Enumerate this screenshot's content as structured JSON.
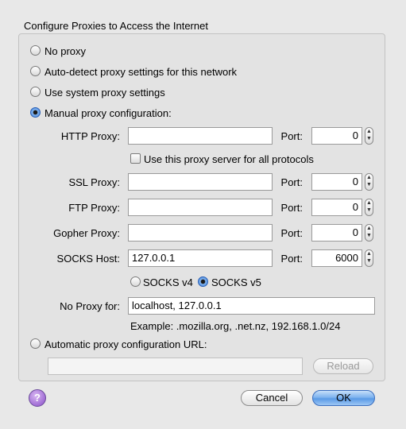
{
  "dialog": {
    "title": "Configure Proxies to Access the Internet"
  },
  "options": {
    "no_proxy": "No proxy",
    "auto_detect": "Auto-detect proxy settings for this network",
    "system": "Use system proxy settings",
    "manual": "Manual proxy configuration:",
    "auto_url": "Automatic proxy configuration URL:"
  },
  "selected_option": "manual",
  "manual": {
    "port_label": "Port:",
    "http": {
      "label": "HTTP Proxy:",
      "value": "",
      "port": "0"
    },
    "use_all": "Use this proxy server for all protocols",
    "ssl": {
      "label": "SSL Proxy:",
      "value": "",
      "port": "0"
    },
    "ftp": {
      "label": "FTP Proxy:",
      "value": "",
      "port": "0"
    },
    "gopher": {
      "label": "Gopher Proxy:",
      "value": "",
      "port": "0"
    },
    "socks": {
      "label": "SOCKS Host:",
      "value": "127.0.0.1",
      "port": "6000"
    },
    "socks_v4": "SOCKS v4",
    "socks_v5": "SOCKS v5",
    "socks_selected": "v5",
    "no_proxy_for": {
      "label": "No Proxy for:",
      "value": "localhost, 127.0.0.1"
    },
    "example": "Example: .mozilla.org, .net.nz, 192.168.1.0/24"
  },
  "auto_url": {
    "value": "",
    "reload_label": "Reload"
  },
  "footer": {
    "help": "?",
    "cancel": "Cancel",
    "ok": "OK"
  },
  "icons": {
    "help": "question-mark",
    "stepper_up": "▲",
    "stepper_down": "▼"
  }
}
